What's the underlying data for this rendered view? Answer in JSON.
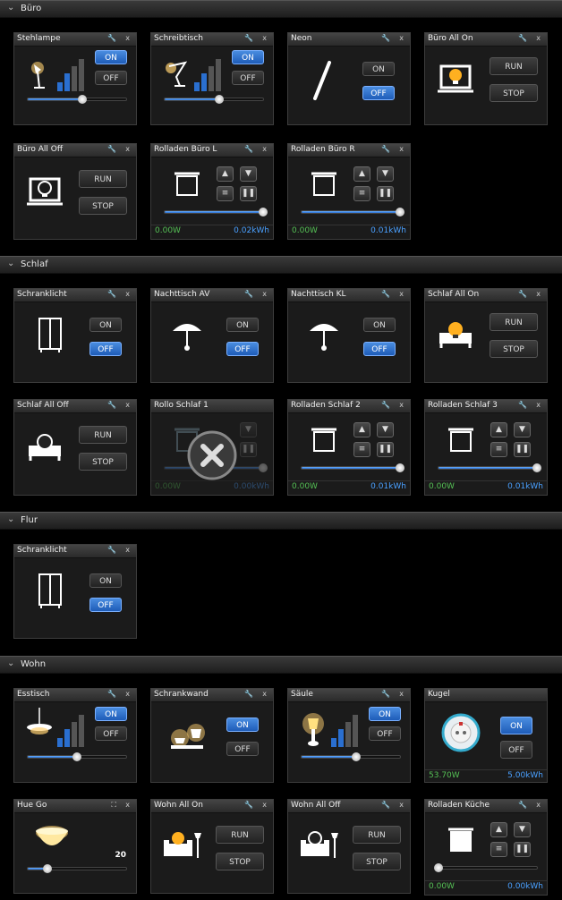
{
  "sections": [
    {
      "key": "buero",
      "title": "Büro"
    },
    {
      "key": "schlaf",
      "title": "Schlaf"
    },
    {
      "key": "flur",
      "title": "Flur"
    },
    {
      "key": "wohn",
      "title": "Wohn"
    }
  ],
  "labels": {
    "on": "ON",
    "off": "OFF",
    "run": "RUN",
    "stop": "STOP"
  },
  "widgets": {
    "stehlampe": {
      "title": "Stehlampe",
      "level": 0.55
    },
    "schreibtisch": {
      "title": "Schreibtisch",
      "level": 0.55
    },
    "neon": {
      "title": "Neon"
    },
    "buero_all_on": {
      "title": "Büro All On"
    },
    "buero_all_off": {
      "title": "Büro All Off"
    },
    "rolladen_buero_l": {
      "title": "Rolladen Büro L",
      "power": "0.00W",
      "energy": "0.02kWh",
      "position": 1.0
    },
    "rolladen_buero_r": {
      "title": "Rolladen Büro R",
      "power": "0.00W",
      "energy": "0.01kWh",
      "position": 1.0
    },
    "schranklicht_schlaf": {
      "title": "Schranklicht"
    },
    "nachttisch_av": {
      "title": "Nachttisch AV"
    },
    "nachttisch_kl": {
      "title": "Nachttisch KL"
    },
    "schlaf_all_on": {
      "title": "Schlaf All On"
    },
    "schlaf_all_off": {
      "title": "Schlaf All Off"
    },
    "rollo_schlaf_1": {
      "title": "Rollo Schlaf 1",
      "power": "0.00W",
      "energy": "0.00kWh",
      "position": 1.0
    },
    "rolladen_schlaf_2": {
      "title": "Rolladen Schlaf 2",
      "power": "0.00W",
      "energy": "0.01kWh",
      "position": 1.0
    },
    "rolladen_schlaf_3": {
      "title": "Rolladen Schlaf 3",
      "power": "0.00W",
      "energy": "0.01kWh",
      "position": 1.0
    },
    "schranklicht_flur": {
      "title": "Schranklicht"
    },
    "esstisch": {
      "title": "Esstisch",
      "level": 0.5
    },
    "schrankwand": {
      "title": "Schrankwand"
    },
    "saeule": {
      "title": "Säule",
      "level": 0.55
    },
    "kugel": {
      "title": "Kugel",
      "power": "53.70W",
      "energy": "5.00kWh"
    },
    "hue_go": {
      "title": "Hue Go",
      "value": "20",
      "level": 0.2
    },
    "wohn_all_on": {
      "title": "Wohn All On"
    },
    "wohn_all_off": {
      "title": "Wohn All Off"
    },
    "rolladen_kueche": {
      "title": "Rolladen Küche",
      "power": "0.00W",
      "energy": "0.00kWh",
      "position": 0.0
    }
  },
  "icons": {
    "wrench": "wrench-icon",
    "close": "close-icon",
    "chevron": "chevron-down-icon"
  },
  "colors": {
    "accent": "#2a6fd0",
    "power_text": "#55c055",
    "energy_text": "#4aa0ff",
    "lamp_glow": "#ffd070"
  }
}
